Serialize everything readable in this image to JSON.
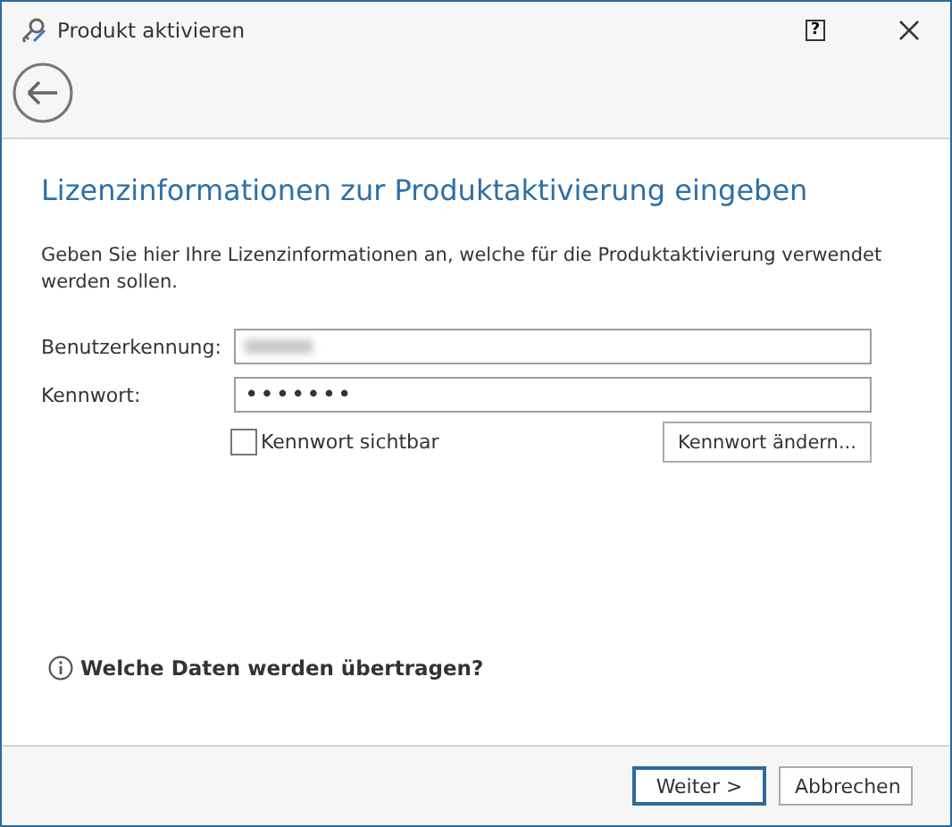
{
  "window": {
    "title": "Produkt aktivieren",
    "help_button": "?"
  },
  "heading": "Lizenzinformationen zur Produktaktivierung eingeben",
  "description": "Geben Sie hier Ihre Lizenzinformationen an, welche für die Produktaktivierung verwendet werden sollen.",
  "fields": [
    {
      "label": "Benutzerkennung:",
      "kind": "blurred"
    },
    {
      "label": "Kennwort:",
      "kind": "password",
      "value": "•••••••"
    }
  ],
  "show_password": {
    "label": "Kennwort sichtbar",
    "checked": false
  },
  "change_password_button": "Kennwort ändern...",
  "info_link": "Welche Daten werden übertragen?",
  "buttons": [
    {
      "label": "Weiter >",
      "default": true
    },
    {
      "label": "Abbrechen",
      "default": false
    }
  ]
}
